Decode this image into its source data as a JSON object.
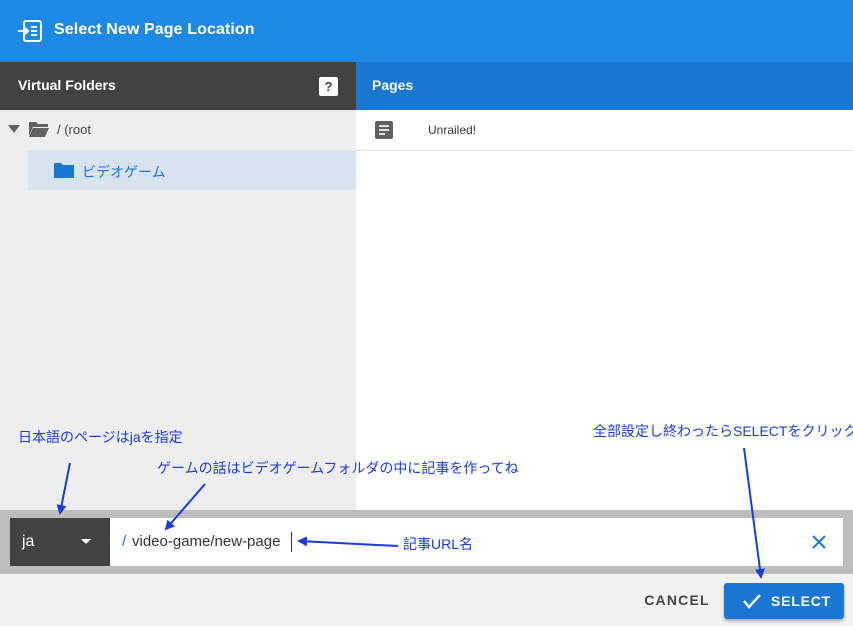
{
  "dialog": {
    "title": "Select New Page Location",
    "title_icon": "page-location-icon"
  },
  "folders": {
    "header": "Virtual Folders",
    "help_label": "?",
    "root_label": "/ (root",
    "items": [
      {
        "label": "ビデオゲーム",
        "icon": "folder-icon",
        "selected": true
      }
    ]
  },
  "pages": {
    "header": "Pages",
    "items": [
      {
        "label": "Unrailed!",
        "icon": "document-icon"
      }
    ]
  },
  "path": {
    "locale": "ja",
    "slash": "/",
    "value": " video-game/new-page"
  },
  "actions": {
    "cancel": "CANCEL",
    "select": "SELECT"
  },
  "annotations": {
    "locale_note": "日本語のページはjaを指定",
    "folder_note": "ゲームの話はビデオゲームフォルダの中に記事を作ってね",
    "url_note": "記事URL名",
    "select_note": "全部設定し終わったらSELECTをクリック"
  },
  "colors": {
    "accent": "#1976d2",
    "title_bar": "#1e88e5",
    "dark_header": "#424242",
    "annotation": "#1a3cd8"
  }
}
